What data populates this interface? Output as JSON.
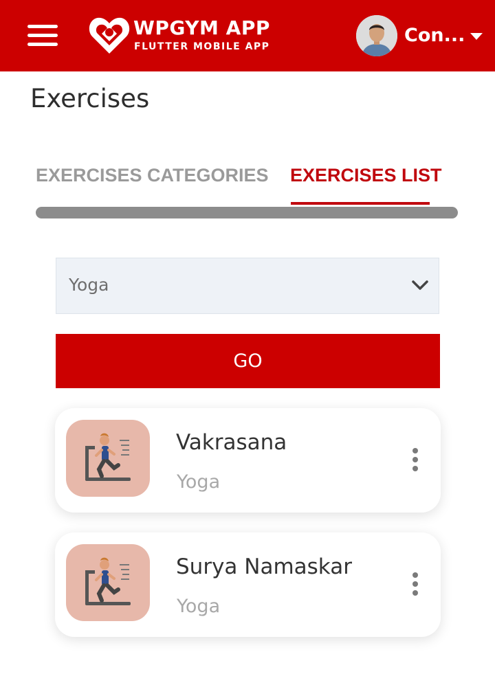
{
  "header": {
    "brand_title": "WPGYM APP",
    "brand_subtitle": "FLUTTER MOBILE APP",
    "user_name": "Con...",
    "bar_color": "#cc0000",
    "icons": [
      "menu-icon",
      "heart-logo-icon",
      "avatar",
      "caret-down-icon"
    ]
  },
  "page": {
    "title": "Exercises"
  },
  "tabs": [
    {
      "label": "EXERCISES CATEGORIES",
      "active": false
    },
    {
      "label": "EXERCISES LIST",
      "active": true
    }
  ],
  "filter": {
    "selected": "Yoga",
    "chevron_icon": "chevron-down-icon",
    "go_label": "GO"
  },
  "exercises": [
    {
      "name": "Vakrasana",
      "category": "Yoga",
      "icon": "treadmill-runner-icon"
    },
    {
      "name": "Surya Namaskar",
      "category": "Yoga",
      "icon": "treadmill-runner-icon"
    }
  ],
  "accent_color": "#c0080e"
}
